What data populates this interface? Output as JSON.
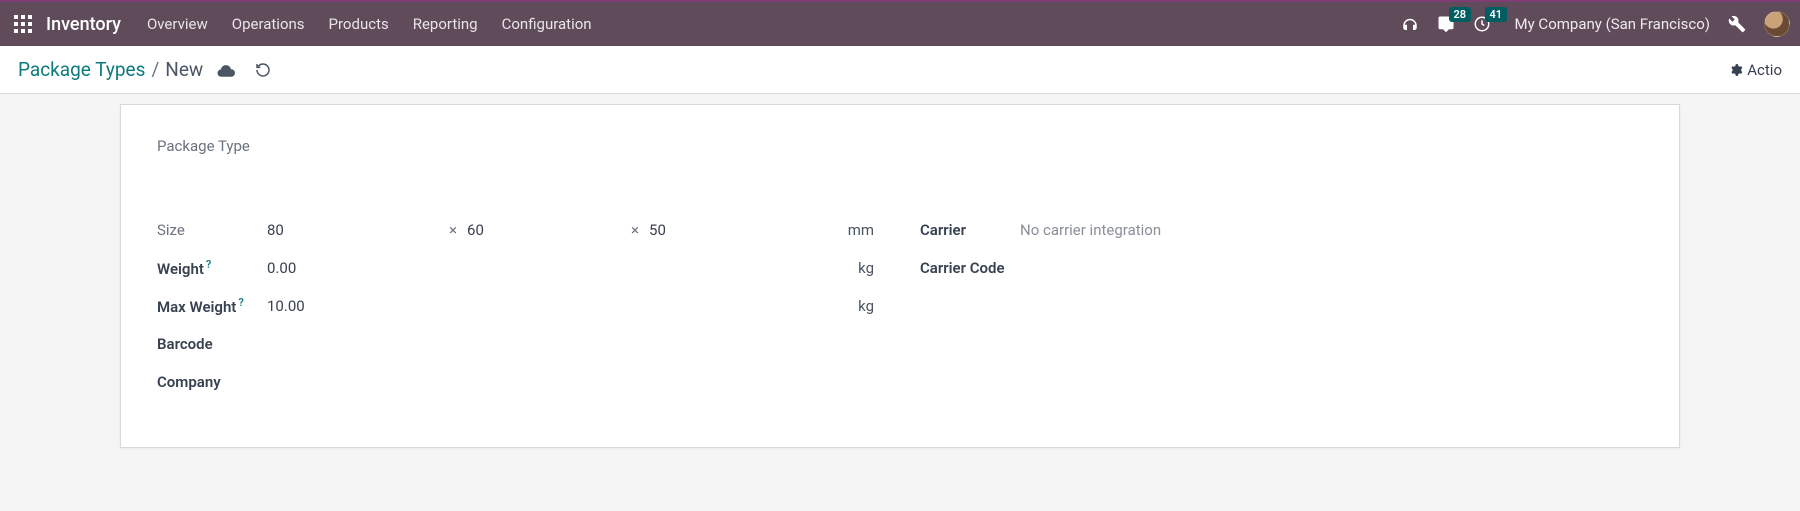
{
  "topbar": {
    "app_title": "Inventory",
    "menu": [
      "Overview",
      "Operations",
      "Products",
      "Reporting",
      "Configuration"
    ],
    "messages_badge": "28",
    "activities_badge": "41",
    "company": "My Company (San Francisco)"
  },
  "breadcrumb": {
    "parent": "Package Types",
    "sep": "/",
    "current": "New",
    "actions_label": "Actio"
  },
  "form": {
    "title_label": "Package Type",
    "left": {
      "size_label": "Size",
      "size_l": "80",
      "size_w": "60",
      "size_h": "50",
      "size_times": "×",
      "size_unit": "mm",
      "weight_label": "Weight",
      "weight_val": "0.00",
      "weight_unit": "kg",
      "maxw_label": "Max Weight",
      "maxw_val": "10.00",
      "maxw_unit": "kg",
      "barcode_label": "Barcode",
      "company_label": "Company",
      "help_q": "?"
    },
    "right": {
      "carrier_label": "Carrier",
      "carrier_val": "No carrier integration",
      "ccode_label": "Carrier Code"
    }
  }
}
